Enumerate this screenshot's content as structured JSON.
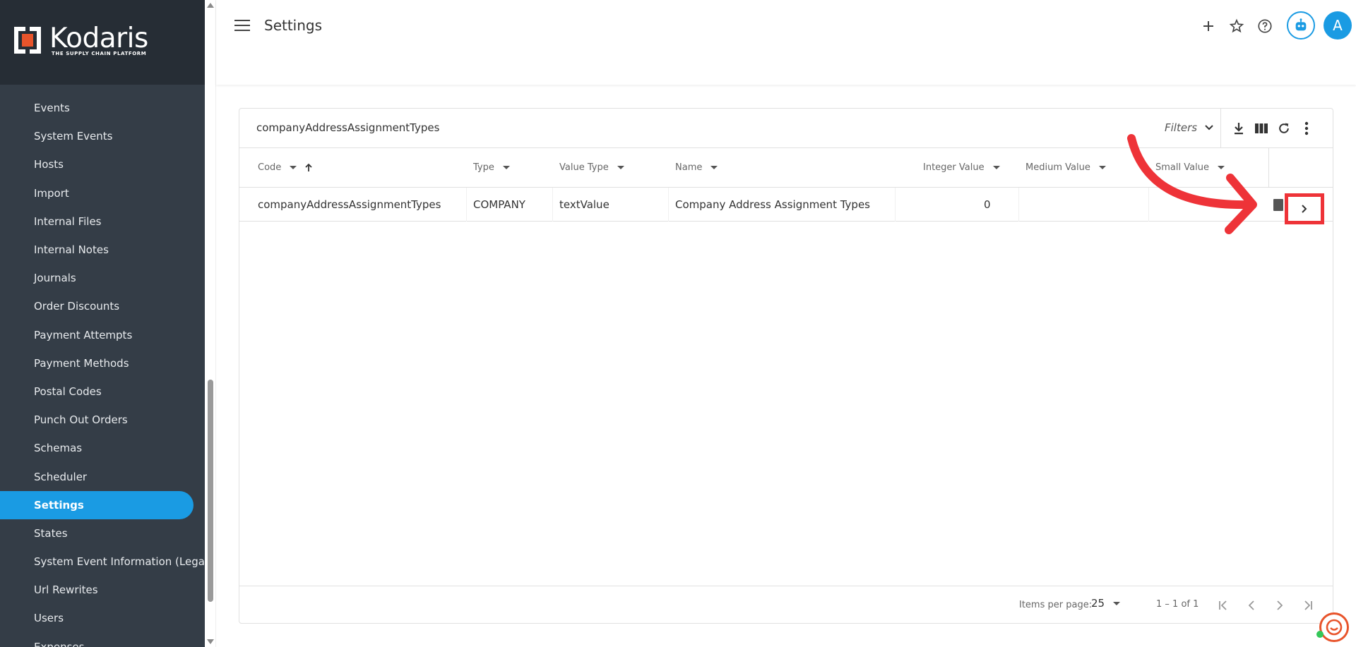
{
  "brand": {
    "name": "Kodaris",
    "tagline": "THE SUPPLY CHAIN PLATFORM",
    "accent_color": "#1a9be3",
    "logo_color": "#e8542b"
  },
  "sidebar": {
    "items": [
      {
        "label": "Events"
      },
      {
        "label": "System Events"
      },
      {
        "label": "Hosts"
      },
      {
        "label": "Import"
      },
      {
        "label": "Internal Files"
      },
      {
        "label": "Internal Notes"
      },
      {
        "label": "Journals"
      },
      {
        "label": "Order Discounts"
      },
      {
        "label": "Payment Attempts"
      },
      {
        "label": "Payment Methods"
      },
      {
        "label": "Postal Codes"
      },
      {
        "label": "Punch Out Orders"
      },
      {
        "label": "Schemas"
      },
      {
        "label": "Scheduler"
      },
      {
        "label": "Settings",
        "active": true
      },
      {
        "label": "States"
      },
      {
        "label": "System Event Information (Legacy)"
      },
      {
        "label": "Url Rewrites"
      },
      {
        "label": "Users"
      },
      {
        "label": "Expenses"
      }
    ]
  },
  "header": {
    "title": "Settings",
    "avatar_initial": "A",
    "icons": [
      "menu-icon",
      "plus-icon",
      "star-icon",
      "help-icon",
      "robot-icon"
    ]
  },
  "table": {
    "title": "companyAddressAssignmentTypes",
    "filters_label": "Filters",
    "columns": [
      {
        "label": "Code"
      },
      {
        "label": "Type"
      },
      {
        "label": "Value Type"
      },
      {
        "label": "Name"
      },
      {
        "label": "Integer Value"
      },
      {
        "label": "Medium Value"
      },
      {
        "label": "Small Value"
      }
    ],
    "rows": [
      {
        "code": "companyAddressAssignmentTypes",
        "type": "COMPANY",
        "value_type": "textValue",
        "name": "Company Address Assignment Types",
        "integer_value": "0",
        "medium_value": "",
        "small_value": ""
      }
    ],
    "pagination": {
      "items_per_page_label": "Items per page:",
      "items_per_page": "25",
      "range": "1 – 1 of 1"
    }
  },
  "annotation": {
    "highlight_color": "#ee3338"
  }
}
